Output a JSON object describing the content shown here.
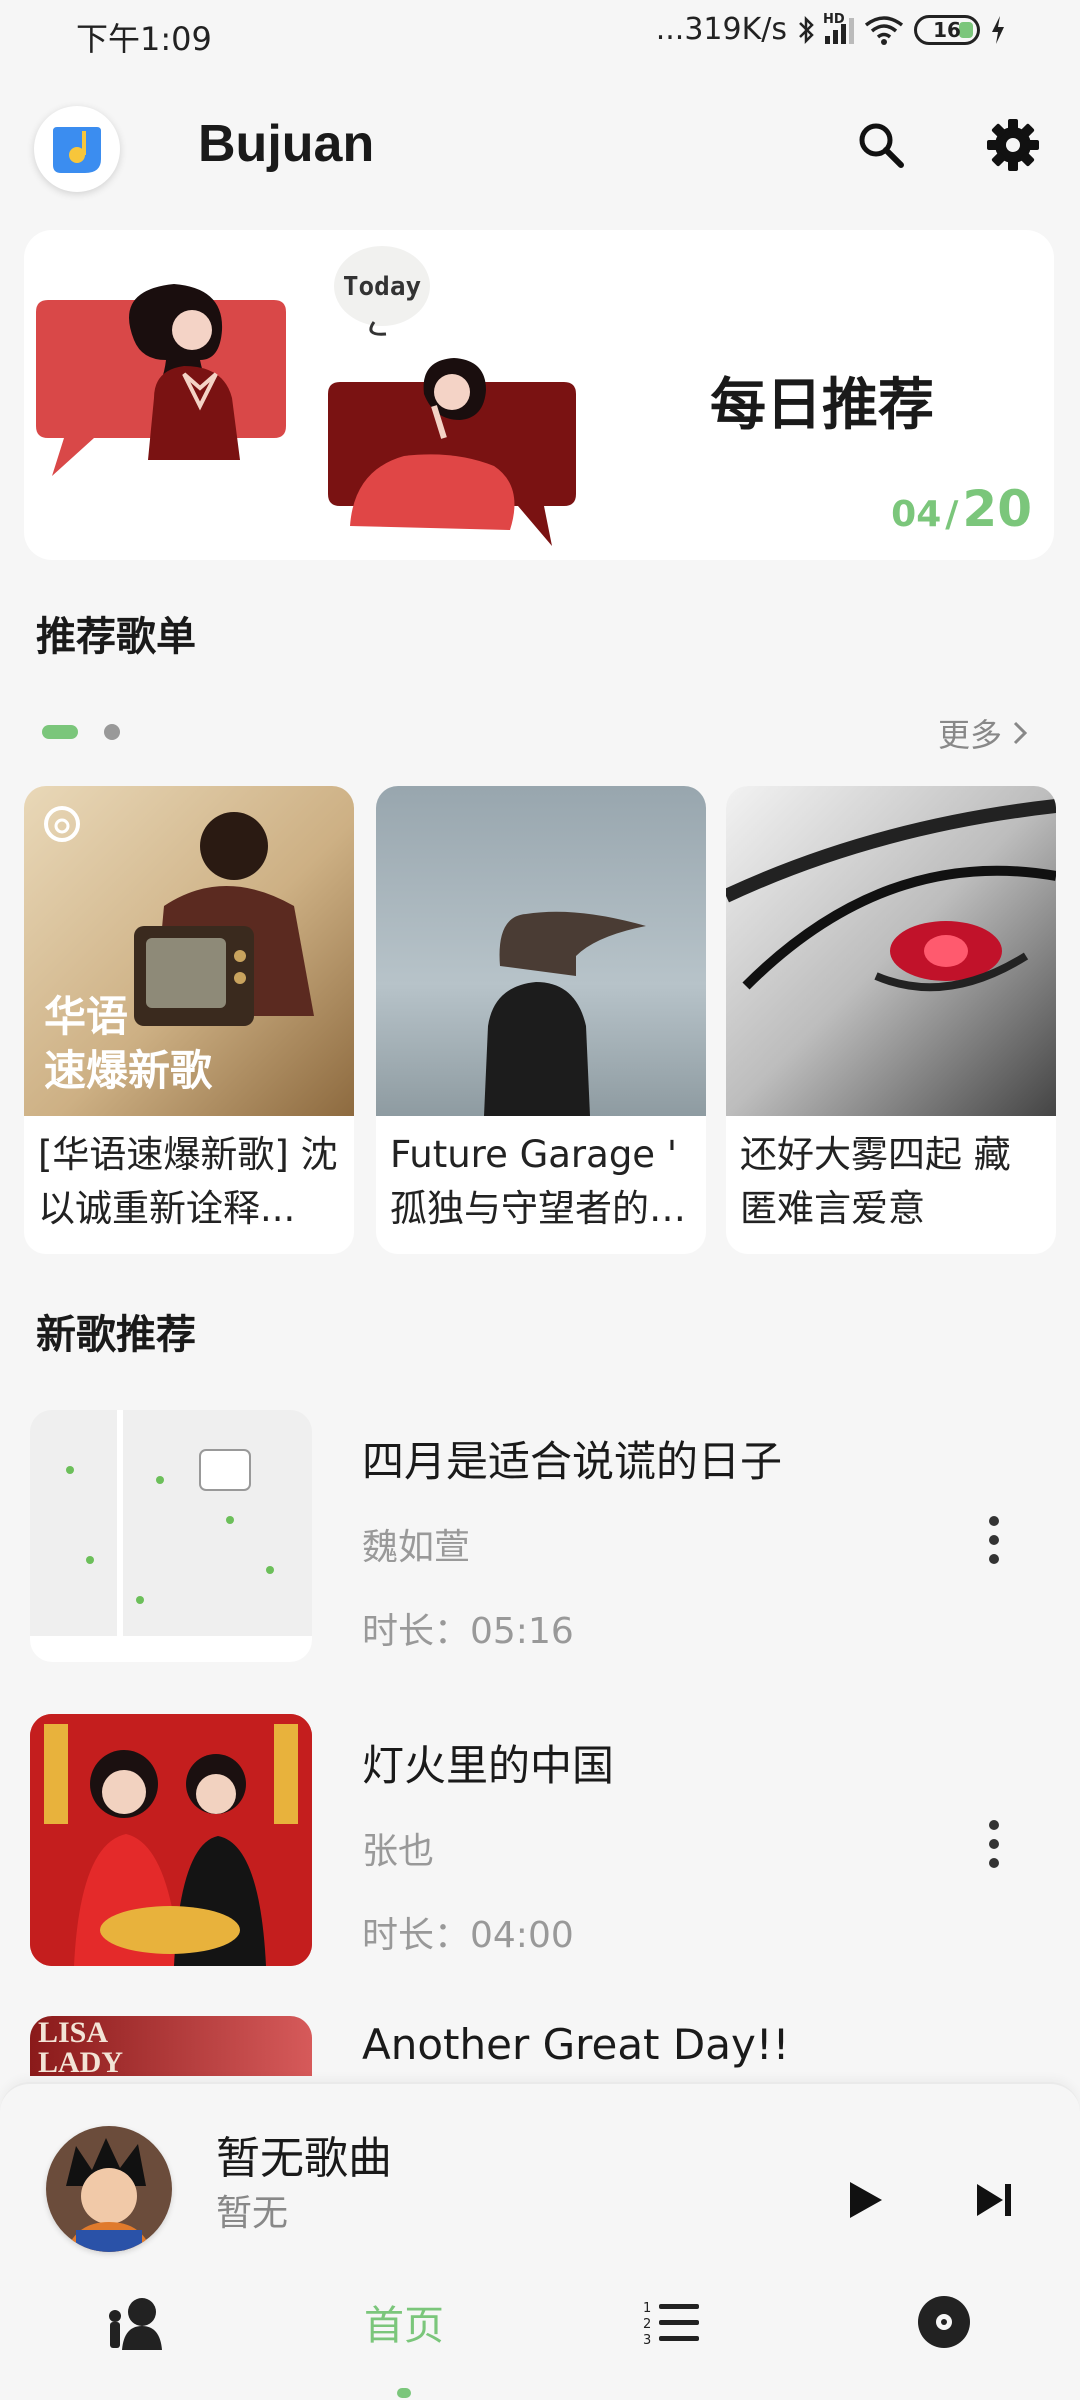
{
  "status_bar": {
    "time": "下午1:09",
    "network_speed": "...319K/s",
    "network_type": "HD",
    "battery": "16"
  },
  "app": {
    "title": "Bujuan"
  },
  "daily": {
    "badge": "Today",
    "title": "每日推荐",
    "month": "04",
    "day": "20"
  },
  "playlists_section": {
    "title": "推荐歌单",
    "more_label": "更多",
    "items": [
      {
        "cover_text_line1": "华语",
        "cover_text_line2": "速爆新歌",
        "name": "[华语速爆新歌] 沈以诚重新诠释..."
      },
      {
        "name": "Future Garage ' 孤独与守望者的悲..."
      },
      {
        "name": "还好大雾四起 藏匿难言爱意"
      }
    ]
  },
  "songs_section": {
    "title": "新歌推荐",
    "items": [
      {
        "title": "四月是适合说谎的日子",
        "artist": "魏如萱",
        "duration": "时长：05:16"
      },
      {
        "title": "灯火里的中国",
        "artist": "张也",
        "duration": "时长：04:00"
      },
      {
        "title": "Another Great Day!!",
        "cover_text": "LISA LADY"
      }
    ]
  },
  "player": {
    "title": "暂无歌曲",
    "artist": "暂无"
  },
  "bottom_nav": {
    "home_label": "首页"
  },
  "colors": {
    "accent": "#7bc67b",
    "banner_red": "#d94848",
    "dark_red": "#7a1212"
  }
}
